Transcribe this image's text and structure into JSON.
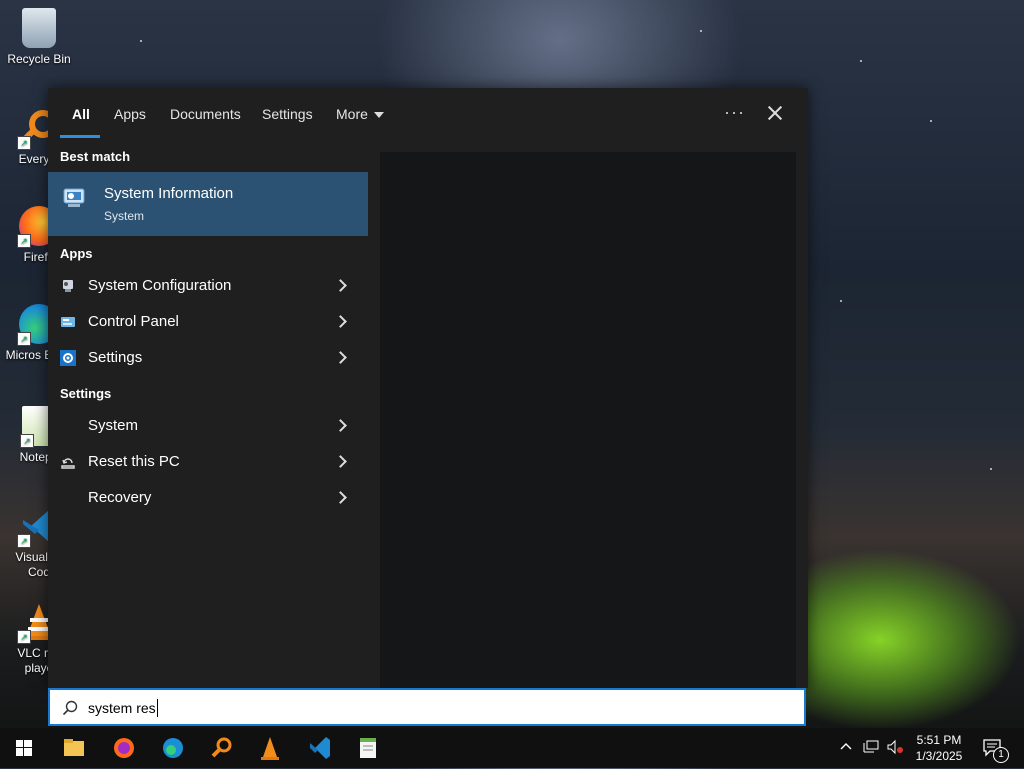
{
  "desktop": {
    "icons": [
      {
        "label": "Recycle Bin"
      },
      {
        "label": "Everyth"
      },
      {
        "label": "Firefo"
      },
      {
        "label": "Micros Edge"
      },
      {
        "label": "Notepa"
      },
      {
        "label": "Visual St Cod"
      },
      {
        "label": "VLC me playe"
      }
    ]
  },
  "search": {
    "tabs": [
      {
        "label": "All"
      },
      {
        "label": "Apps"
      },
      {
        "label": "Documents"
      },
      {
        "label": "Settings"
      },
      {
        "label": "More"
      }
    ],
    "active_tab": "All",
    "more_icon": "ellipsis-icon",
    "close_icon": "close-icon",
    "best_match": {
      "section": "Best match",
      "title": "System Information",
      "subtitle": "System",
      "icon": "system-information-icon"
    },
    "apps": {
      "section": "Apps",
      "items": [
        {
          "label": "System Configuration",
          "icon": "system-configuration-icon"
        },
        {
          "label": "Control Panel",
          "icon": "control-panel-icon"
        },
        {
          "label": "Settings",
          "icon": "gear-icon"
        }
      ]
    },
    "settings": {
      "section": "Settings",
      "items": [
        {
          "label": "System",
          "icon": ""
        },
        {
          "label": "Reset this PC",
          "icon": "reset-pc-icon"
        },
        {
          "label": "Recovery",
          "icon": ""
        }
      ]
    },
    "query": "system res",
    "search_icon": "search-icon"
  },
  "taskbar": {
    "apps": [
      "start-icon",
      "file-explorer-icon",
      "firefox-icon",
      "edge-icon",
      "everything-icon",
      "vlc-icon",
      "vscode-icon",
      "notepad-icon"
    ],
    "time": "5:51 PM",
    "date": "1/3/2025",
    "notification_count": "1"
  },
  "colors": {
    "panel_bg": "#1f1f1f",
    "selected_bg": "#2c5273",
    "accent": "#2f8fdd"
  }
}
